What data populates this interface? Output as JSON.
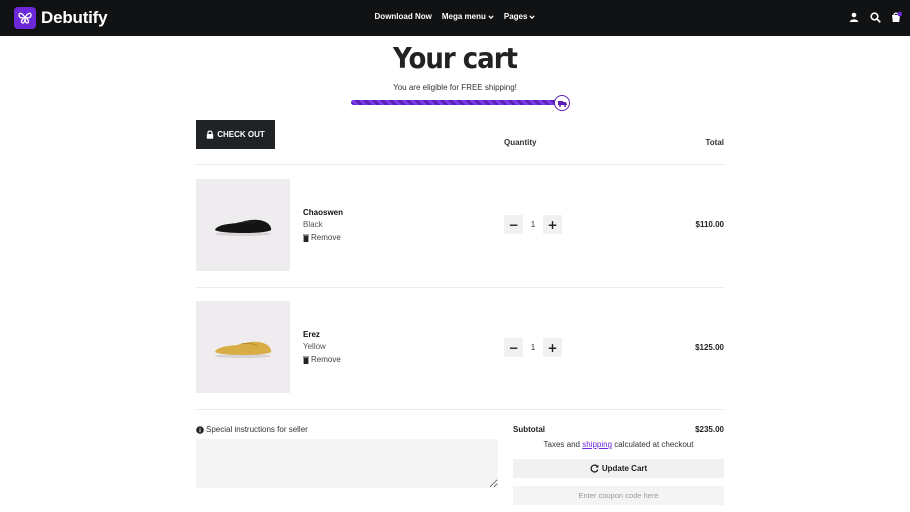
{
  "header": {
    "brand": "Debutify",
    "nav": [
      {
        "label": "Download Now",
        "has_caret": false
      },
      {
        "label": "Mega menu",
        "has_caret": true
      },
      {
        "label": "Pages",
        "has_caret": true
      }
    ],
    "icons": [
      "user-icon",
      "search-icon",
      "cart-icon"
    ],
    "brand_color": "#6d28d9"
  },
  "cart": {
    "title": "Your cart",
    "shipping_message": "You are eligible for FREE shipping!",
    "shipping_progress_percent": 100,
    "checkout_label": "CHECK OUT",
    "quantity_header": "Quantity",
    "total_header": "Total",
    "items": [
      {
        "name": "Chaoswen",
        "variant": "Black",
        "remove_label": "Remove",
        "quantity": "1",
        "total": "$110.00"
      },
      {
        "name": "Erez",
        "variant": "Yellow",
        "remove_label": "Remove",
        "quantity": "1",
        "total": "$125.00"
      }
    ],
    "instructions_label": "Special instructions for seller",
    "subtotal_label": "Subtotal",
    "subtotal_value": "$235.00",
    "taxes_before": "Taxes and",
    "taxes_link": "shipping",
    "taxes_after": "calculated at checkout",
    "update_label": "Update Cart",
    "coupon_placeholder": "Enter coupon code here"
  }
}
